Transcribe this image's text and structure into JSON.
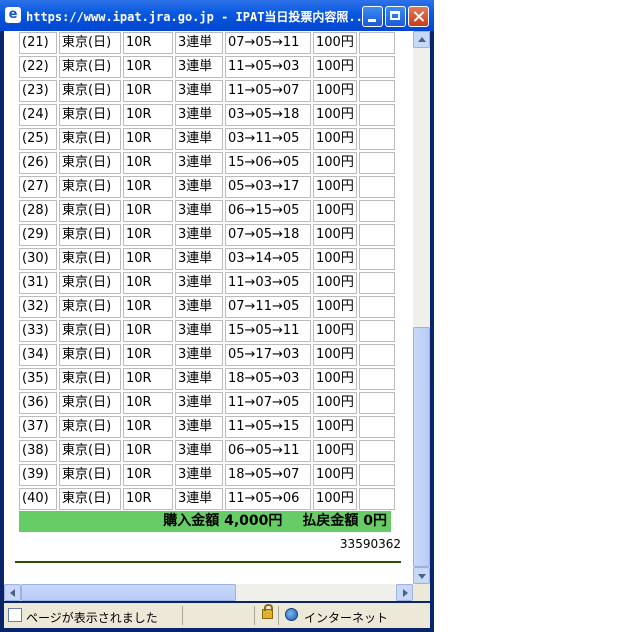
{
  "window": {
    "title": "https://www.ipat.jra.go.jp - IPAT当日投票内容照..."
  },
  "bets": {
    "rows": [
      {
        "no": "(21)",
        "place": "東京(日)",
        "race": "10R",
        "type": "3連単",
        "combo": "07→05→11",
        "amount": "100円"
      },
      {
        "no": "(22)",
        "place": "東京(日)",
        "race": "10R",
        "type": "3連単",
        "combo": "11→05→03",
        "amount": "100円"
      },
      {
        "no": "(23)",
        "place": "東京(日)",
        "race": "10R",
        "type": "3連単",
        "combo": "11→05→07",
        "amount": "100円"
      },
      {
        "no": "(24)",
        "place": "東京(日)",
        "race": "10R",
        "type": "3連単",
        "combo": "03→05→18",
        "amount": "100円"
      },
      {
        "no": "(25)",
        "place": "東京(日)",
        "race": "10R",
        "type": "3連単",
        "combo": "03→11→05",
        "amount": "100円"
      },
      {
        "no": "(26)",
        "place": "東京(日)",
        "race": "10R",
        "type": "3連単",
        "combo": "15→06→05",
        "amount": "100円"
      },
      {
        "no": "(27)",
        "place": "東京(日)",
        "race": "10R",
        "type": "3連単",
        "combo": "05→03→17",
        "amount": "100円"
      },
      {
        "no": "(28)",
        "place": "東京(日)",
        "race": "10R",
        "type": "3連単",
        "combo": "06→15→05",
        "amount": "100円"
      },
      {
        "no": "(29)",
        "place": "東京(日)",
        "race": "10R",
        "type": "3連単",
        "combo": "07→05→18",
        "amount": "100円"
      },
      {
        "no": "(30)",
        "place": "東京(日)",
        "race": "10R",
        "type": "3連単",
        "combo": "03→14→05",
        "amount": "100円"
      },
      {
        "no": "(31)",
        "place": "東京(日)",
        "race": "10R",
        "type": "3連単",
        "combo": "11→03→05",
        "amount": "100円"
      },
      {
        "no": "(32)",
        "place": "東京(日)",
        "race": "10R",
        "type": "3連単",
        "combo": "07→11→05",
        "amount": "100円"
      },
      {
        "no": "(33)",
        "place": "東京(日)",
        "race": "10R",
        "type": "3連単",
        "combo": "15→05→11",
        "amount": "100円"
      },
      {
        "no": "(34)",
        "place": "東京(日)",
        "race": "10R",
        "type": "3連単",
        "combo": "05→17→03",
        "amount": "100円"
      },
      {
        "no": "(35)",
        "place": "東京(日)",
        "race": "10R",
        "type": "3連単",
        "combo": "18→05→03",
        "amount": "100円"
      },
      {
        "no": "(36)",
        "place": "東京(日)",
        "race": "10R",
        "type": "3連単",
        "combo": "11→07→05",
        "amount": "100円"
      },
      {
        "no": "(37)",
        "place": "東京(日)",
        "race": "10R",
        "type": "3連単",
        "combo": "11→05→15",
        "amount": "100円"
      },
      {
        "no": "(38)",
        "place": "東京(日)",
        "race": "10R",
        "type": "3連単",
        "combo": "06→05→11",
        "amount": "100円"
      },
      {
        "no": "(39)",
        "place": "東京(日)",
        "race": "10R",
        "type": "3連単",
        "combo": "18→05→07",
        "amount": "100円"
      },
      {
        "no": "(40)",
        "place": "東京(日)",
        "race": "10R",
        "type": "3連単",
        "combo": "11→05→06",
        "amount": "100円"
      }
    ]
  },
  "summary": {
    "purchase_label": "購入金額",
    "purchase_value": "4,000円",
    "refund_label": "払戻金額",
    "refund_value": "0円"
  },
  "reference_number": "33590362",
  "statusbar": {
    "status_text": "ページが表示されました",
    "zone_text": "インターネット"
  },
  "icons": {
    "browser": "ie-icon",
    "secure": "lock-icon",
    "zone": "globe-icon",
    "page": "page-icon"
  },
  "colors": {
    "summary_bg": "#66cc66",
    "titlebar": "#0a5ae0"
  }
}
